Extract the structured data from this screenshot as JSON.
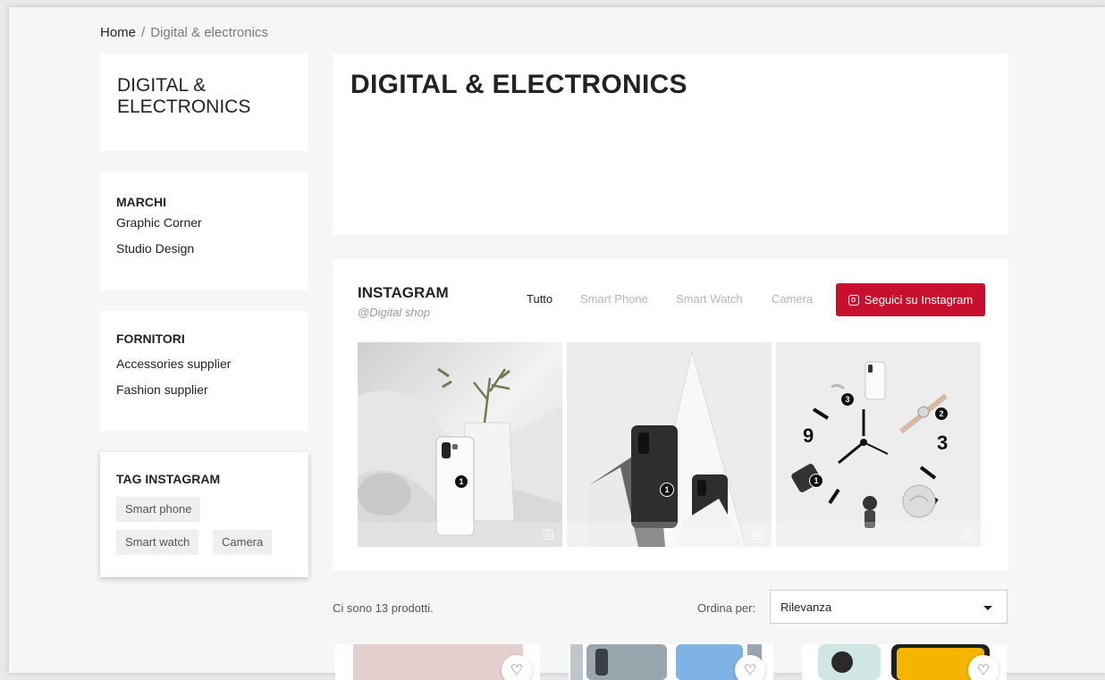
{
  "breadcrumb": {
    "home": "Home",
    "separator": "/",
    "current": "Digital & electronics"
  },
  "sidebar": {
    "category_title": "DIGITAL & ELECTRONICS",
    "brands": {
      "title": "MARCHI",
      "items": [
        "Graphic Corner",
        "Studio Design"
      ]
    },
    "suppliers": {
      "title": "FORNITORI",
      "items": [
        "Accessories supplier",
        "Fashion supplier"
      ]
    },
    "tags": {
      "title": "TAG INSTAGRAM",
      "items": [
        "Smart phone",
        "Smart watch",
        "Camera"
      ]
    }
  },
  "header": {
    "title": "DIGITAL & ELECTRONICS"
  },
  "instagram": {
    "title": "INSTAGRAM",
    "handle": "@Digital shop",
    "filters": [
      "Tutto",
      "Smart Phone",
      "Smart Watch",
      "Camera"
    ],
    "active_filter": "Tutto",
    "follow_label": "Seguici su Instagram",
    "accent_color": "#c8102e",
    "photos": [
      {
        "name": "photo-phone-vase",
        "markers": [
          "1"
        ]
      },
      {
        "name": "photo-phones-geometric",
        "markers": [
          "1"
        ]
      },
      {
        "name": "photo-clock-flatlay",
        "markers": [
          "3",
          "2",
          "1"
        ]
      }
    ]
  },
  "listing": {
    "count_text": "Ci sono 13 prodotti.",
    "sort_label": "Ordina per:",
    "sort_value": "Rilevanza"
  },
  "icons": {
    "wishlist": "heart-icon",
    "instagram": "instagram-icon",
    "dropdown": "chevron-down-icon"
  }
}
